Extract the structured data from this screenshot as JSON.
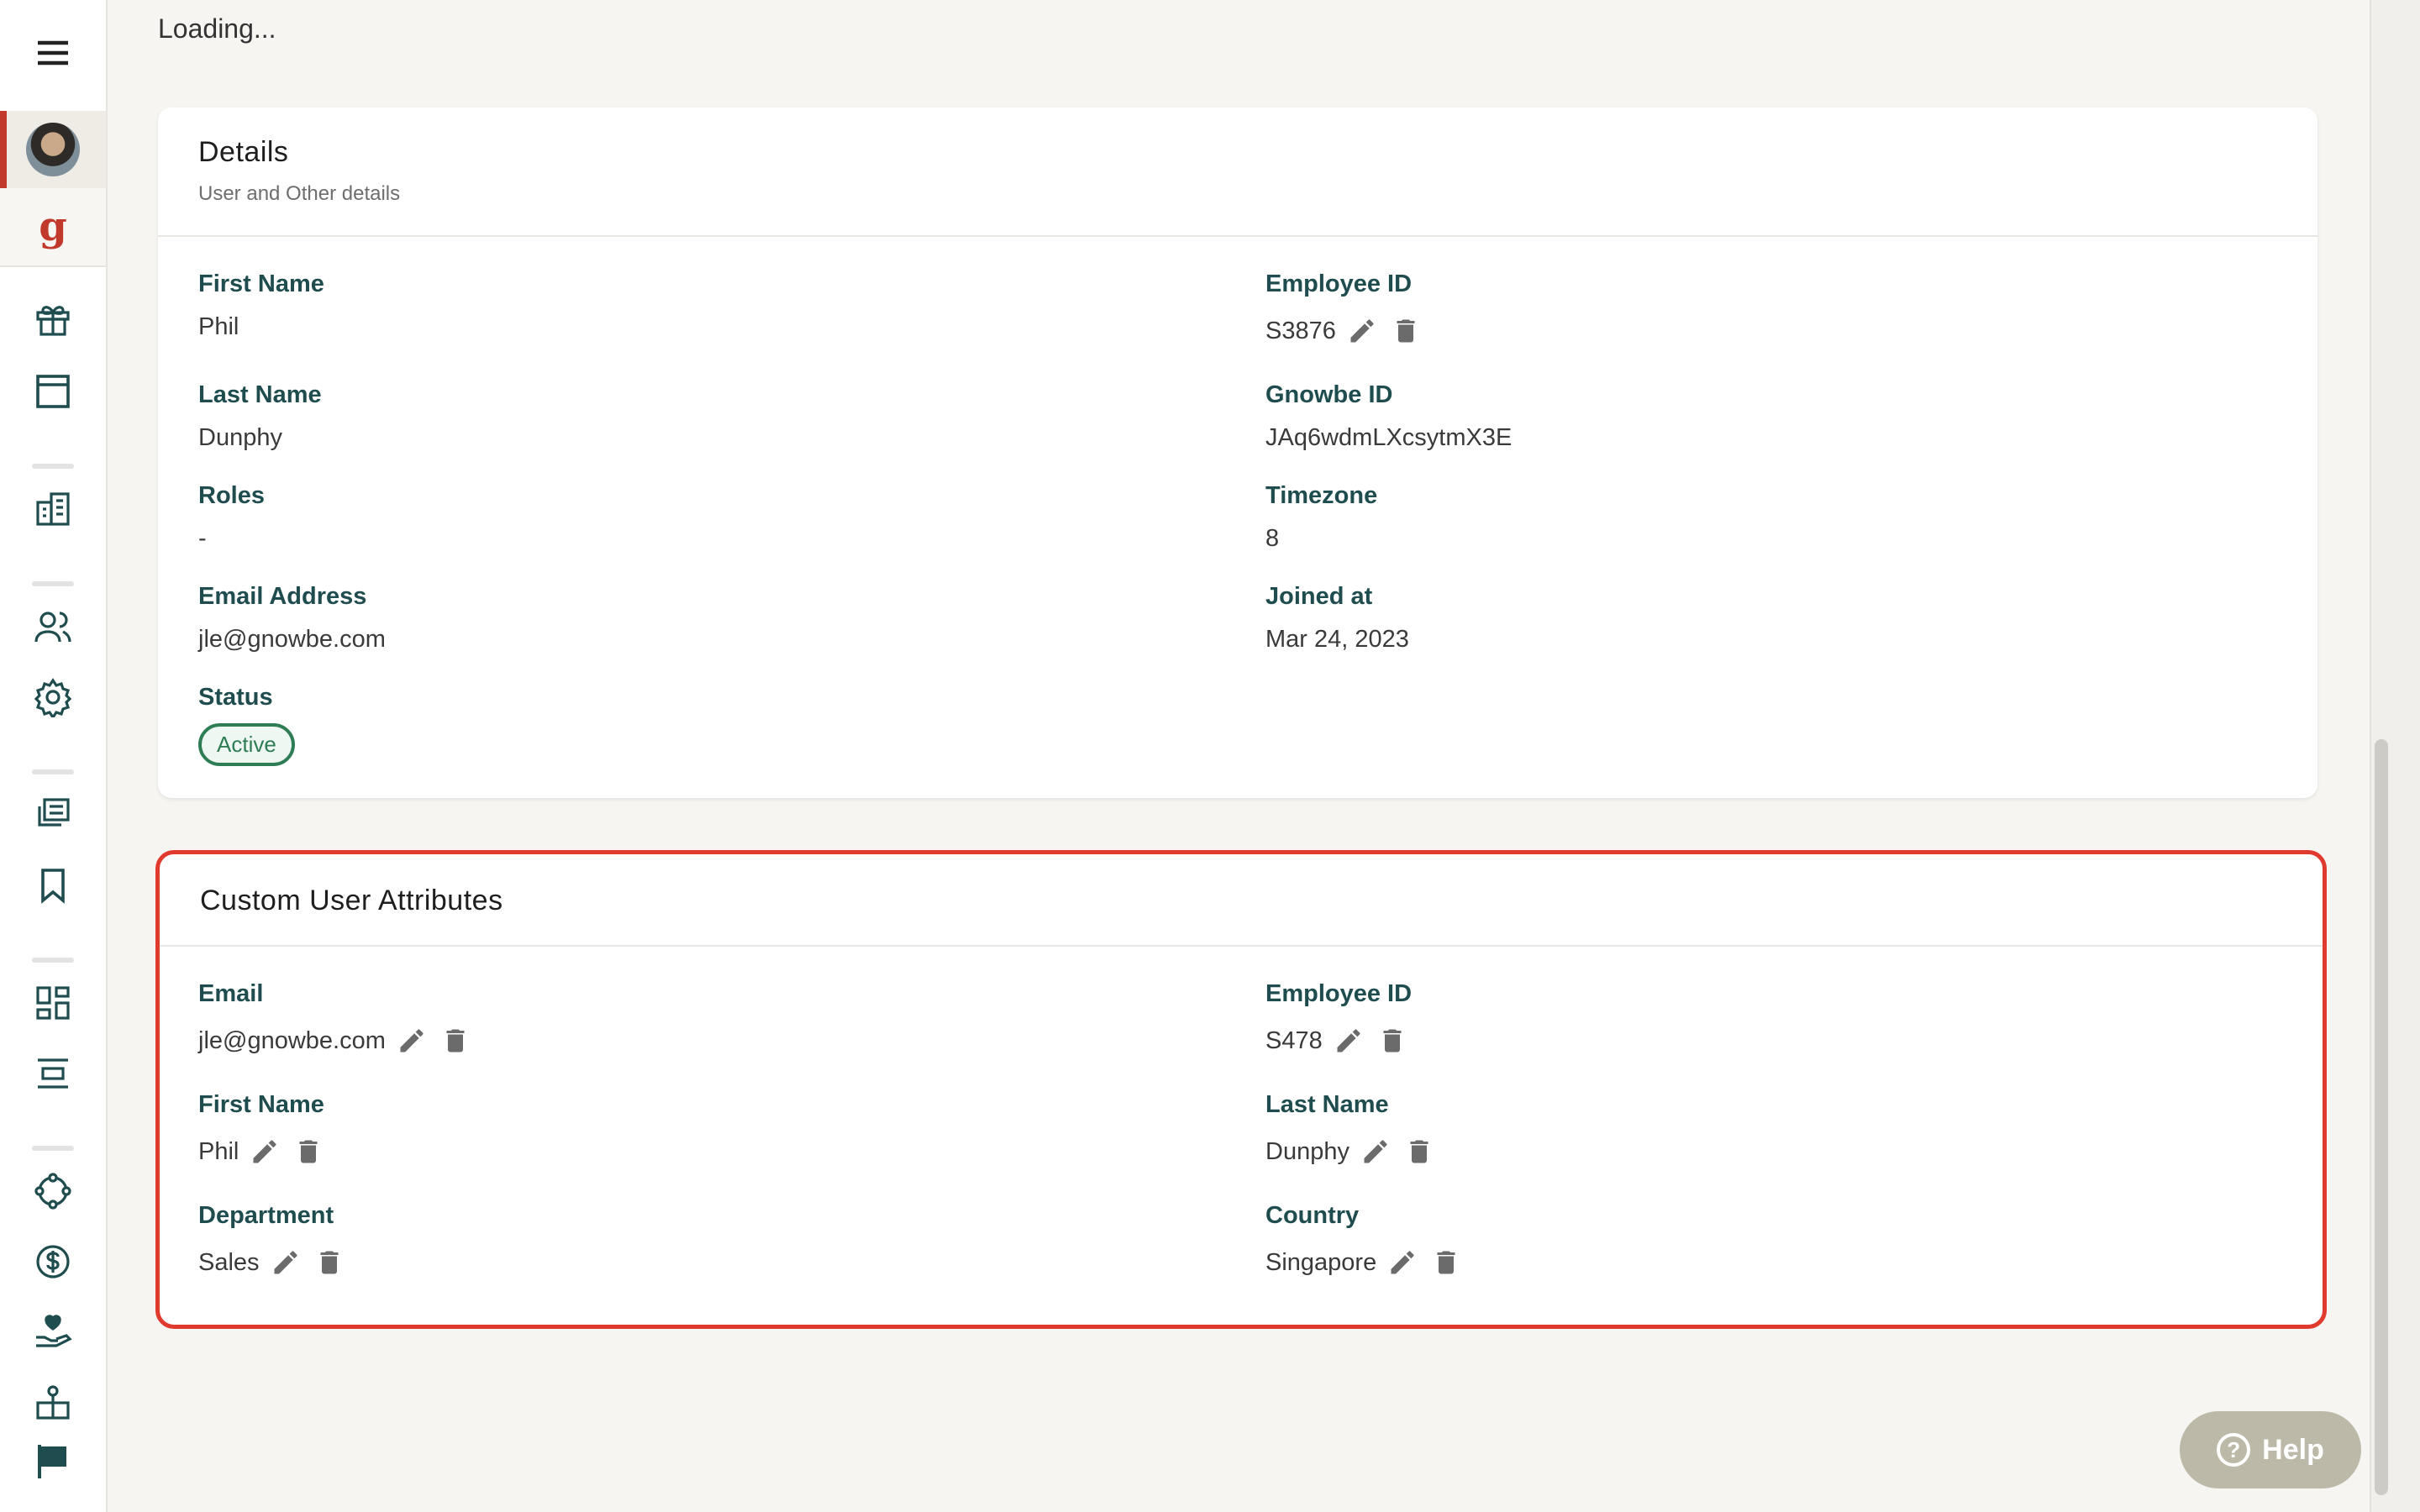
{
  "loading_text": "Loading...",
  "details": {
    "title": "Details",
    "subtitle": "User and Other details",
    "fields": {
      "first_name": {
        "label": "First Name",
        "value": "Phil"
      },
      "last_name": {
        "label": "Last Name",
        "value": "Dunphy"
      },
      "roles": {
        "label": "Roles",
        "value": "-"
      },
      "email": {
        "label": "Email Address",
        "value": "jle@gnowbe.com"
      },
      "status": {
        "label": "Status",
        "value": "Active"
      },
      "employee_id": {
        "label": "Employee ID",
        "value": "S3876"
      },
      "gnowbe_id": {
        "label": "Gnowbe ID",
        "value": "JAq6wdmLXcsytmX3E"
      },
      "timezone": {
        "label": "Timezone",
        "value": "8"
      },
      "joined_at": {
        "label": "Joined at",
        "value": "Mar 24, 2023"
      }
    }
  },
  "custom": {
    "title": "Custom User Attributes",
    "fields": {
      "email": {
        "label": "Email",
        "value": "jle@gnowbe.com"
      },
      "first_name": {
        "label": "First Name",
        "value": "Phil"
      },
      "department": {
        "label": "Department",
        "value": "Sales"
      },
      "employee_id": {
        "label": "Employee ID",
        "value": "S478"
      },
      "last_name": {
        "label": "Last Name",
        "value": "Dunphy"
      },
      "country": {
        "label": "Country",
        "value": "Singapore"
      }
    }
  },
  "help": {
    "label": "Help",
    "icon": "?"
  },
  "sidebar": {
    "logo": "g"
  },
  "colors": {
    "accent": "#c0392b",
    "label": "#1f4d4f",
    "highlight_border": "#e03a2f",
    "status": "#2e7d55"
  }
}
